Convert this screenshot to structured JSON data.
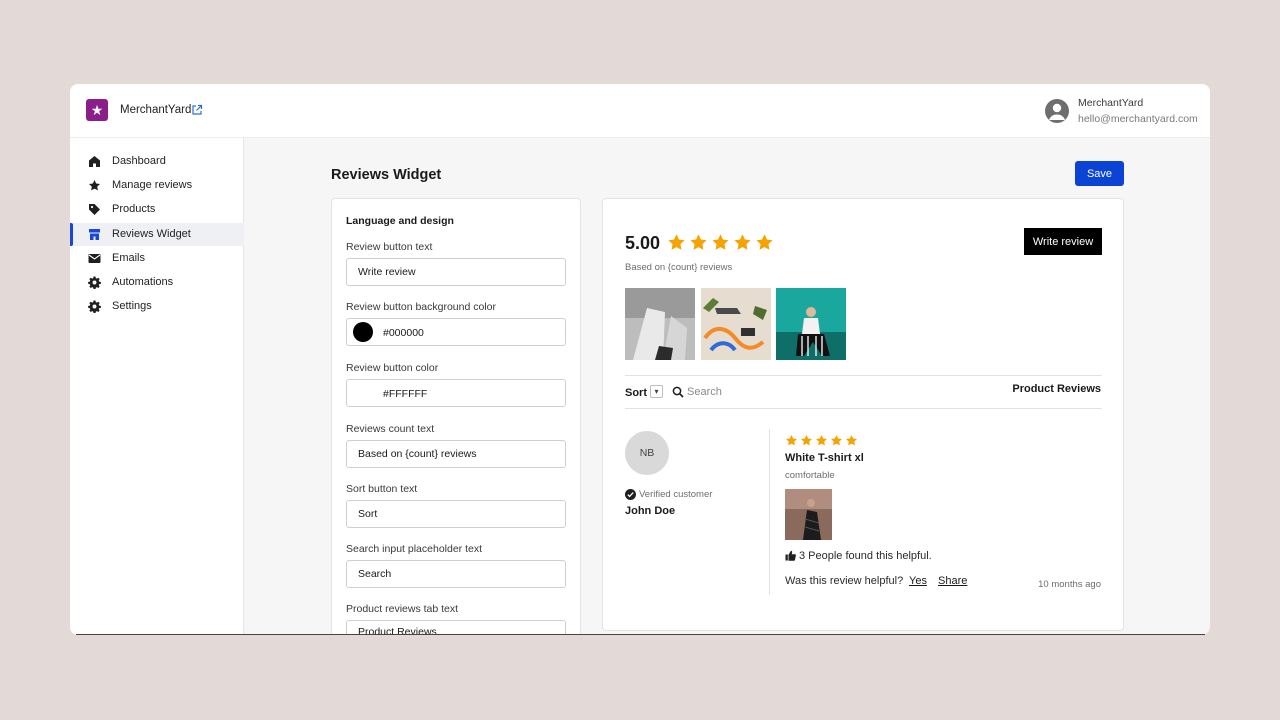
{
  "header": {
    "store_name": "MerchantYard",
    "user_name": "MerchantYard",
    "user_email": "hello@merchantyard.com"
  },
  "sidebar": {
    "items": [
      {
        "label": "Dashboard",
        "icon": "home-icon"
      },
      {
        "label": "Manage reviews",
        "icon": "star-icon"
      },
      {
        "label": "Products",
        "icon": "tag-icon"
      },
      {
        "label": "Reviews Widget",
        "icon": "store-icon",
        "active": true
      },
      {
        "label": "Emails",
        "icon": "mail-icon"
      },
      {
        "label": "Automations",
        "icon": "gear-icon"
      },
      {
        "label": "Settings",
        "icon": "gear-icon"
      }
    ]
  },
  "page": {
    "title": "Reviews Widget",
    "save_label": "Save"
  },
  "settings": {
    "section_title": "Language and design",
    "fields": [
      {
        "label": "Review button text",
        "value": "Write review"
      },
      {
        "label": "Review button background color",
        "value": "#000000",
        "swatch": "#000000"
      },
      {
        "label": "Review button color",
        "value": "#FFFFFF",
        "swatch": "#FFFFFF"
      },
      {
        "label": "Reviews count text",
        "value": "Based on {count} reviews"
      },
      {
        "label": "Sort button text",
        "value": "Sort"
      },
      {
        "label": "Search input placeholder text",
        "value": "Search"
      },
      {
        "label": "Product reviews tab text",
        "value": "Product Reviews"
      }
    ]
  },
  "preview": {
    "rating": "5.00",
    "stars": 5,
    "based_on": "Based on {count} reviews",
    "write_review_label": "Write review",
    "sort_label": "Sort",
    "search_placeholder": "Search",
    "tab_label": "Product Reviews",
    "review": {
      "initials": "NB",
      "verified_label": "Verified customer",
      "reviewer": "John Doe",
      "stars": 5,
      "title": "White T-shirt xl",
      "body": "comfortable",
      "helpful_count": "3 People found this helpful.",
      "helpful_question": "Was this review helpful?",
      "yes_label": "Yes",
      "share_label": "Share",
      "time": "10 months ago"
    }
  },
  "colors": {
    "accent": "#0b43d4",
    "brand": "#8a1f8a",
    "star": "#f4a300"
  }
}
